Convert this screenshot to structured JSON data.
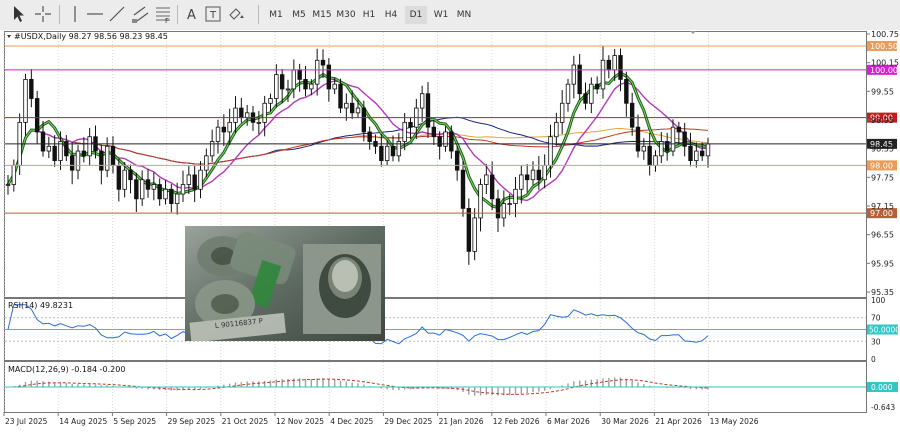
{
  "toolbar": {
    "tools": [
      {
        "name": "cursor-icon"
      },
      {
        "name": "crosshair-icon"
      },
      {
        "name": "vertical-line-icon"
      },
      {
        "name": "horizontal-line-icon"
      },
      {
        "name": "trendline-icon"
      },
      {
        "name": "equidistant-channel-icon"
      },
      {
        "name": "fibonacci-icon"
      },
      {
        "name": "text-tool-icon"
      },
      {
        "name": "shapes-icon"
      }
    ],
    "timeframes": [
      "M1",
      "M5",
      "M15",
      "M30",
      "H1",
      "H4",
      "D1",
      "W1",
      "MN"
    ],
    "active_timeframe": "D1"
  },
  "main_chart": {
    "header": "#USDX,Daily  98.27 98.56 98.23 98.45",
    "price_ticks": [
      "100.75",
      "100.15",
      "99.55",
      "98.95",
      "98.35",
      "97.75",
      "97.15",
      "96.55",
      "95.95",
      "95.35"
    ],
    "price_lines": [
      {
        "label": "100.50",
        "color": "#e89c57"
      },
      {
        "label": "100.00",
        "color": "#d51ed5"
      },
      {
        "label": "99.00",
        "color": "#c41d1d"
      },
      {
        "label": "98.45",
        "color": "#222222"
      },
      {
        "label": "98.00",
        "color": "#e89c57"
      },
      {
        "label": "97.00",
        "color": "#b3603b"
      }
    ]
  },
  "rsi": {
    "header": "RSI(14) 49.8231",
    "ticks": [
      "100",
      "70",
      "50.0000",
      "30",
      "0"
    ]
  },
  "macd": {
    "header": "MACD(12,26,9) -0.184 -0.200",
    "ticks": [
      "0.000",
      "-0.643"
    ]
  },
  "date_axis": [
    "23 Jul 2025",
    "14 Aug 2025",
    "5 Sep 2025",
    "29 Sep 2025",
    "21 Oct 2025",
    "12 Nov 2025",
    "4 Dec 2025",
    "29 Dec 2025",
    "21 Jan 2026",
    "12 Feb 2026",
    "6 Mar 2026",
    "30 Mar 2026",
    "21 Apr 2026",
    "13 May 2026"
  ],
  "chart_data": {
    "type": "candlestick",
    "symbol": "#USDX",
    "period": "Daily",
    "ohlc_last": {
      "open": 98.27,
      "high": 98.56,
      "low": 98.23,
      "close": 98.45
    },
    "ylim": [
      95.35,
      100.75
    ],
    "closes": [
      97.6,
      98.0,
      98.9,
      99.8,
      99.4,
      98.7,
      98.3,
      98.4,
      98.1,
      98.5,
      98.2,
      97.9,
      98.3,
      98.2,
      98.6,
      98.3,
      97.9,
      98.4,
      98.0,
      97.5,
      97.9,
      97.7,
      97.3,
      97.7,
      97.5,
      97.6,
      97.3,
      97.5,
      97.2,
      97.4,
      97.6,
      97.8,
      97.5,
      97.9,
      98.2,
      98.5,
      98.8,
      98.7,
      98.9,
      99.2,
      99.0,
      99.1,
      98.9,
      98.9,
      99.3,
      99.4,
      99.9,
      99.6,
      99.6,
      100.0,
      99.8,
      99.6,
      99.7,
      100.2,
      100.1,
      99.6,
      99.7,
      99.2,
      99.3,
      99.1,
      99.2,
      98.7,
      98.5,
      98.4,
      98.1,
      98.4,
      98.2,
      98.5,
      98.9,
      98.8,
      99.2,
      99.5,
      98.8,
      98.6,
      98.4,
      98.7,
      98.3,
      97.9,
      97.1,
      96.2,
      96.9,
      97.6,
      97.8,
      97.3,
      96.9,
      97.2,
      97.2,
      97.5,
      97.8,
      97.7,
      97.9,
      97.7,
      98.0,
      98.6,
      98.9,
      99.3,
      99.7,
      100.1,
      99.5,
      99.3,
      99.7,
      99.6,
      100.2,
      100.0,
      100.3,
      99.8,
      99.3,
      98.8,
      98.3,
      98.4,
      98.0,
      98.2,
      98.5,
      98.3,
      98.8,
      98.7,
      98.4,
      98.1,
      98.3,
      98.2,
      98.45
    ],
    "indicators": [
      {
        "name": "RSI(14)",
        "value": 49.8231,
        "levels": [
          70,
          50,
          30
        ]
      },
      {
        "name": "MACD(12,26,9)",
        "values": [
          -0.184,
          -0.2
        ]
      }
    ]
  }
}
